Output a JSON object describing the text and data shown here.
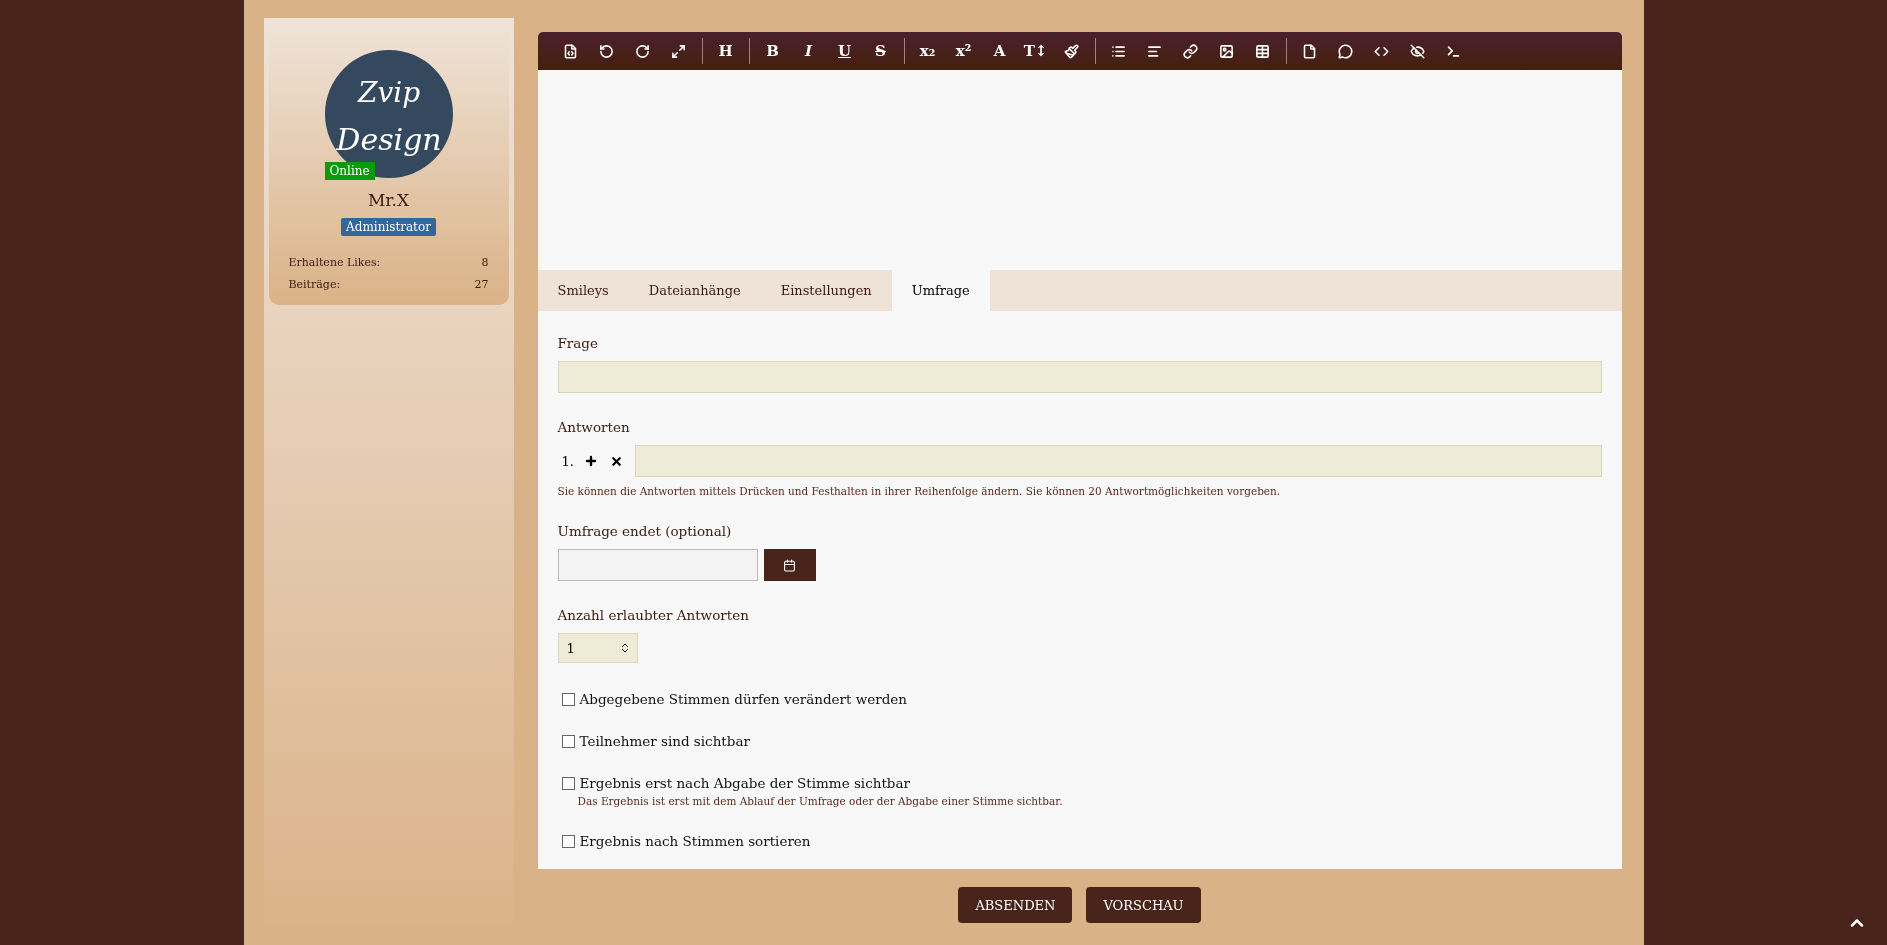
{
  "profile": {
    "logo_lines": [
      "Zvip",
      "Design"
    ],
    "status": "Online",
    "online": true,
    "name": "Mr.X",
    "role": "Administrator",
    "stats": [
      {
        "label": "Erhaltene Likes:",
        "value": "8"
      },
      {
        "label": "Beiträge:",
        "value": "27"
      }
    ]
  },
  "toolbar": [
    [
      {
        "kind": "source"
      },
      {
        "kind": "undo"
      },
      {
        "kind": "redo"
      },
      {
        "kind": "fullscreen"
      }
    ],
    [
      {
        "kind": "text",
        "label": "H"
      }
    ],
    [
      {
        "kind": "bold",
        "label": "B"
      },
      {
        "kind": "italic",
        "label": "I"
      },
      {
        "kind": "underline",
        "label": "U"
      },
      {
        "kind": "strike",
        "label": "S"
      }
    ],
    [
      {
        "kind": "text",
        "label": "x₂"
      },
      {
        "kind": "text",
        "label": "x²"
      },
      {
        "kind": "text",
        "label": "A"
      },
      {
        "kind": "text",
        "label": "T↕"
      },
      {
        "kind": "brush"
      }
    ],
    [
      {
        "kind": "list"
      },
      {
        "kind": "align"
      },
      {
        "kind": "link"
      },
      {
        "kind": "image"
      },
      {
        "kind": "table"
      }
    ],
    [
      {
        "kind": "page"
      },
      {
        "kind": "comment"
      },
      {
        "kind": "code"
      },
      {
        "kind": "spoiler"
      },
      {
        "kind": "terminal"
      }
    ]
  ],
  "tabs": [
    {
      "label": "Smileys",
      "selected": false
    },
    {
      "label": "Dateianhänge",
      "selected": false
    },
    {
      "label": "Einstellungen",
      "selected": false
    },
    {
      "label": "Umfrage",
      "selected": true
    }
  ],
  "poll": {
    "question_label": "Frage",
    "answers_label": "Antworten",
    "answers": [
      {
        "number": "1."
      }
    ],
    "answers_hint": "Sie können die Antworten mittels Drücken und Festhalten in ihrer Reihenfolge ändern. Sie können 20 Antwortmöglichkeiten vorgeben.",
    "end_label": "Umfrage endet (optional)",
    "count_label": "Anzahl erlaubter Antworten",
    "count_value": "1",
    "options": [
      {
        "label": "Abgegebene Stimmen dürfen verändert werden",
        "checked": false
      },
      {
        "label": "Teilnehmer sind sichtbar",
        "checked": false
      },
      {
        "label": "Ergebnis erst nach Abgabe der Stimme sichtbar",
        "checked": false,
        "hint": "Das Ergebnis ist erst mit dem Ablauf der Umfrage oder der Abgabe einer Stimme sichtbar."
      },
      {
        "label": "Ergebnis nach Stimmen sortieren",
        "checked": false
      }
    ]
  },
  "buttons": [
    "ABSENDEN",
    "VORSCHAU"
  ]
}
